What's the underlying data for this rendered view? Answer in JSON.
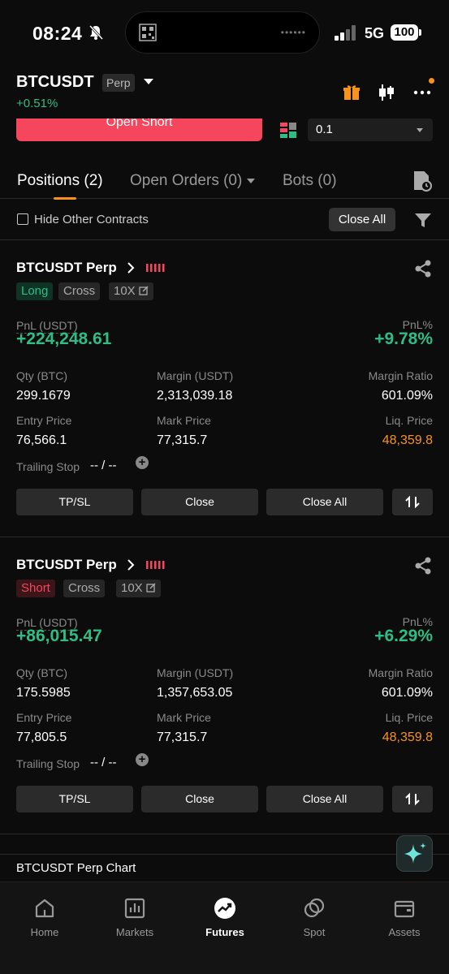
{
  "status_bar": {
    "time": "08:24",
    "network": "5G",
    "battery": "100"
  },
  "header": {
    "pair": "BTCUSDT",
    "contract_type": "Perp",
    "change": "+0.51%"
  },
  "trade_bar": {
    "open_short_label": "Open Short",
    "precision_value": "0.1"
  },
  "tabs": [
    {
      "label": "Positions (2)",
      "active": true
    },
    {
      "label": "Open Orders (0)",
      "active": false
    },
    {
      "label": "Bots (0)",
      "active": false
    }
  ],
  "filter": {
    "hide_label": "Hide Other Contracts",
    "close_all_label": "Close All"
  },
  "labels": {
    "pnl": "PnL (USDT)",
    "pnl_pct": "PnL%",
    "qty": "Qty (BTC)",
    "margin": "Margin (USDT)",
    "margin_ratio": "Margin Ratio",
    "entry_price": "Entry Price",
    "mark_price": "Mark Price",
    "liq_price": "Liq. Price",
    "trailing_stop": "Trailing Stop",
    "trailing_value": "-- / --",
    "tpsl": "TP/SL",
    "close": "Close",
    "close_all": "Close All"
  },
  "positions": [
    {
      "title": "BTCUSDT Perp",
      "side": "Long",
      "margin_mode": "Cross",
      "leverage": "10X",
      "pnl": "+224,248.61",
      "pnl_pct": "+9.78%",
      "qty": "299.1679",
      "margin": "2,313,039.18",
      "margin_ratio": "601.09%",
      "entry_price": "76,566.1",
      "mark_price": "77,315.7",
      "liq_price": "48,359.8"
    },
    {
      "title": "BTCUSDT Perp",
      "side": "Short",
      "margin_mode": "Cross",
      "leverage": "10X",
      "pnl": "+86,015.47",
      "pnl_pct": "+6.29%",
      "qty": "175.5985",
      "margin": "1,357,653.05",
      "margin_ratio": "601.09%",
      "entry_price": "77,805.5",
      "mark_price": "77,315.7",
      "liq_price": "48,359.8"
    }
  ],
  "chart_section": {
    "label": "BTCUSDT Perp Chart"
  },
  "bottom_nav": [
    {
      "label": "Home",
      "icon": "home-icon",
      "active": false
    },
    {
      "label": "Markets",
      "icon": "markets-icon",
      "active": false
    },
    {
      "label": "Futures",
      "icon": "futures-icon",
      "active": true
    },
    {
      "label": "Spot",
      "icon": "spot-icon",
      "active": false
    },
    {
      "label": "Assets",
      "icon": "assets-icon",
      "active": false
    }
  ],
  "colors": {
    "positive": "#2ebd85",
    "negative": "#f6465d",
    "accent": "#f7931a",
    "background": "#0c0c0c"
  }
}
